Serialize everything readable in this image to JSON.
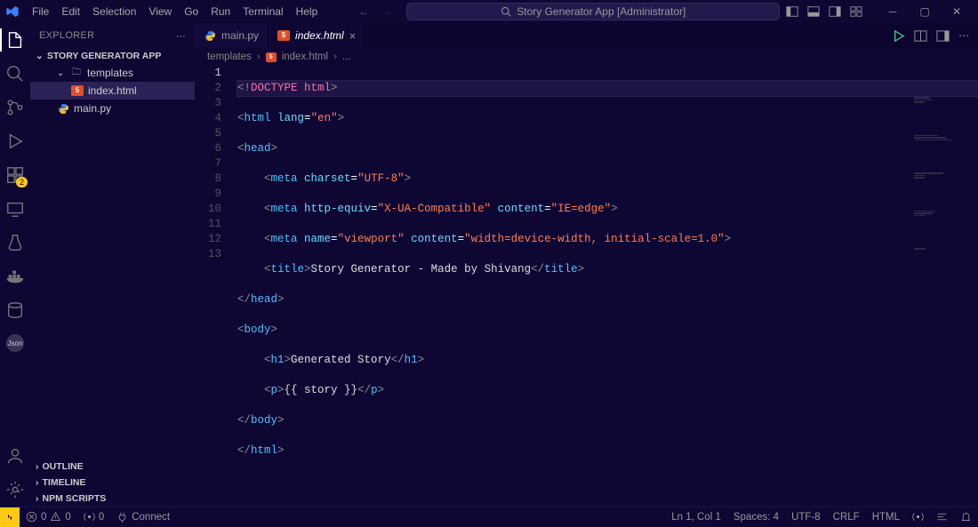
{
  "title": "Story Generator App [Administrator]",
  "menu": [
    "File",
    "Edit",
    "Selection",
    "View",
    "Go",
    "Run",
    "Terminal",
    "Help"
  ],
  "explorer": {
    "header": "EXPLORER",
    "project": "STORY GENERATOR APP",
    "folder": "templates",
    "files": {
      "indexhtml": "index.html",
      "mainpy": "main.py"
    },
    "sections": [
      "OUTLINE",
      "TIMELINE",
      "NPM SCRIPTS"
    ]
  },
  "activity_badge": "2",
  "tabs": {
    "mainpy": "main.py",
    "indexhtml": "index.html"
  },
  "breadcrumb": {
    "a": "templates",
    "b": "index.html",
    "c": "..."
  },
  "code": {
    "lines": [
      "1",
      "2",
      "3",
      "4",
      "5",
      "6",
      "7",
      "8",
      "9",
      "10",
      "11",
      "12",
      "13"
    ],
    "l1a": "<!",
    "l1b": "DOCTYPE",
    "l1c": " html",
    "l1d": ">",
    "l2a": "<",
    "l2b": "html",
    "l2c": " lang",
    "l2d": "=",
    "l2e": "\"en\"",
    "l2f": ">",
    "l3a": "<",
    "l3b": "head",
    "l3c": ">",
    "l4a": "    <",
    "l4b": "meta",
    "l4c": " charset",
    "l4d": "=",
    "l4e": "\"UTF-8\"",
    "l4f": ">",
    "l5a": "    <",
    "l5b": "meta",
    "l5c": " http-equiv",
    "l5d": "=",
    "l5e": "\"X-UA-Compatible\"",
    "l5f": " content",
    "l5g": "=",
    "l5h": "\"IE=edge\"",
    "l5i": ">",
    "l6a": "    <",
    "l6b": "meta",
    "l6c": " name",
    "l6d": "=",
    "l6e": "\"viewport\"",
    "l6f": " content",
    "l6g": "=",
    "l6h": "\"width=device-width, initial-scale=1.0\"",
    "l6i": ">",
    "l7a": "    <",
    "l7b": "title",
    "l7c": ">",
    "l7d": "Story Generator - Made by Shivang",
    "l7e": "</",
    "l7f": "title",
    "l7g": ">",
    "l8a": "</",
    "l8b": "head",
    "l8c": ">",
    "l9a": "<",
    "l9b": "body",
    "l9c": ">",
    "l10a": "    <",
    "l10b": "h1",
    "l10c": ">",
    "l10d": "Generated Story",
    "l10e": "</",
    "l10f": "h1",
    "l10g": ">",
    "l11a": "    <",
    "l11b": "p",
    "l11c": ">",
    "l11d": "{{ story }}",
    "l11e": "</",
    "l11f": "p",
    "l11g": ">",
    "l12a": "</",
    "l12b": "body",
    "l12c": ">",
    "l13a": "</",
    "l13b": "html",
    "l13c": ">"
  },
  "status": {
    "warn_err": "0",
    "warn": "0",
    "ports": "0",
    "connect": "Connect",
    "pos": "Ln 1, Col 1",
    "spaces": "Spaces: 4",
    "encoding": "UTF-8",
    "eol": "CRLF",
    "lang": "HTML"
  }
}
